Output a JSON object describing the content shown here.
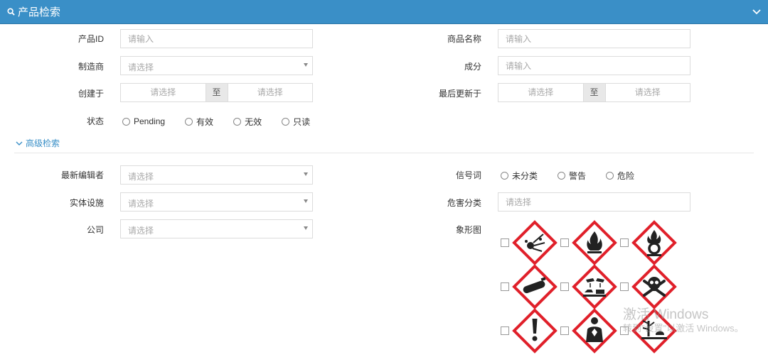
{
  "panel": {
    "title": "产品检索"
  },
  "fields": {
    "product_id": {
      "label": "产品ID",
      "placeholder": "请输入"
    },
    "product_name": {
      "label": "商品名称",
      "placeholder": "请输入"
    },
    "manufacturer": {
      "label": "制造商",
      "placeholder": "请选择"
    },
    "ingredient": {
      "label": "成分",
      "placeholder": "请输入"
    },
    "created_at": {
      "label": "创建于",
      "from": "请选择",
      "sep": "至",
      "to": "请选择"
    },
    "updated_at": {
      "label": "最后更新于",
      "from": "请选择",
      "sep": "至",
      "to": "请选择"
    },
    "status": {
      "label": "状态",
      "options": [
        "Pending",
        "有效",
        "无效",
        "只读"
      ]
    }
  },
  "advanced": {
    "toggle_label": "高级检索",
    "last_editor": {
      "label": "最新编辑者",
      "placeholder": "请选择"
    },
    "signal_word": {
      "label": "信号词",
      "options": [
        "未分类",
        "警告",
        "危险"
      ]
    },
    "facility": {
      "label": "实体设施",
      "placeholder": "请选择"
    },
    "hazard_class": {
      "label": "危害分类",
      "placeholder": "请选择"
    },
    "company": {
      "label": "公司",
      "placeholder": "请选择"
    },
    "pictogram": {
      "label": "象形图",
      "icons": [
        "explosive-icon",
        "flammable-icon",
        "oxidizer-icon",
        "gas-cylinder-icon",
        "corrosive-icon",
        "toxic-skull-icon",
        "exclamation-icon",
        "health-hazard-icon",
        "environment-icon"
      ]
    }
  },
  "watermark": {
    "line1": "激活 Windows",
    "line2": "转到\"设置\"以激活 Windows。"
  },
  "colors": {
    "header": "#3a8fc7",
    "pictogram_border": "#e0202a",
    "link": "#3a8fc7"
  }
}
